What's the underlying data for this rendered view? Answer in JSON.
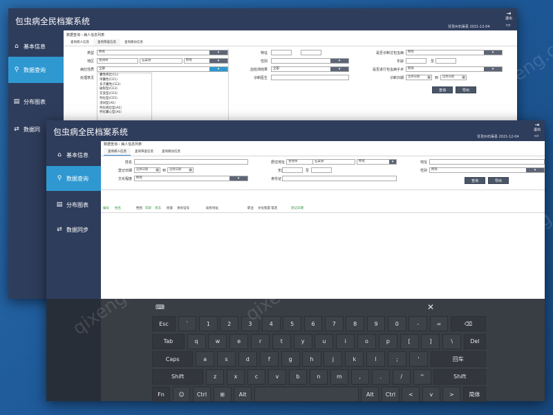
{
  "app": {
    "title": "包虫病全民档案系统",
    "datetime": "甘孜州石渠县 2021-12-04",
    "exit_label": "退出"
  },
  "sidebar": {
    "items": [
      {
        "icon": "home-icon",
        "label": "基本信息"
      },
      {
        "icon": "search-icon",
        "label": "数据查询"
      },
      {
        "icon": "chart-icon",
        "label": "分布图表"
      },
      {
        "icon": "sync-icon",
        "label": "数据同步"
      }
    ],
    "back_items": [
      {
        "label": "基本信息"
      },
      {
        "label": "数据查询"
      },
      {
        "label": "分布图表"
      },
      {
        "label": "数据同"
      }
    ],
    "version": "版本"
  },
  "back_window": {
    "breadcrumb": "数据查询 › 病人信息列表",
    "tabs": [
      "查询病人信息",
      "查询筛查信息",
      "查询随访信息"
    ],
    "fields": {
      "type_label": "类型",
      "type_value": "所有",
      "region_label": "地区",
      "region_city": "甘孜州",
      "region_county": "石渠县",
      "region_town": "所有",
      "lesion_label": "病灶性质",
      "lesion_value": "全部",
      "treatment_label": "处理意见",
      "feature_label": "特征",
      "gender_label": "性别",
      "serum_label": "血检测结果",
      "serum_value": "全部",
      "doctor_label": "诊断医生",
      "ever_diag_label": "是否诊断过包虫病",
      "ever_diag_value": "所有",
      "age_label": "年龄",
      "age_to": "至",
      "surgery_label": "是否进行包虫病手术",
      "surgery_value": "所有",
      "diag_date_label": "诊断日期",
      "date_placeholder": "选择日期",
      "date_to": "到"
    },
    "dropdown_options": [
      "囊性病灶(CL)",
      "单囊性(CE1)",
      "多子囊性(CE2)",
      "破裂型(CE3)",
      "实变型(CE4)",
      "钙化型(CE5)",
      "浸润型(AE)",
      "钙化病灶型(AE)",
      "钙化囊心型(AE)"
    ],
    "query_button": "查询",
    "export_button": "导出"
  },
  "front_window": {
    "breadcrumb": "数据查询 › 病人信息列表",
    "tabs": [
      "查询病人信息",
      "查询筛查信息",
      "查询随访信息"
    ],
    "fields": {
      "name_label": "姓名",
      "reg_date_label": "登记日期",
      "date_placeholder": "选择日期",
      "date_to": "到",
      "education_label": "文化程度",
      "education_value": "所有",
      "residence_label": "居住地址",
      "residence_city": "甘孜州",
      "residence_county": "石渠县",
      "residence_town": "所有",
      "age_label": "年龄",
      "age_to": "至",
      "idcard_label": "身份证",
      "address_label": "地址",
      "gender_label": "性别",
      "gender_value": "所有"
    },
    "query_button": "查询",
    "export_button": "导出",
    "table_headers": [
      {
        "text": "编号",
        "color": "green"
      },
      {
        "text": "姓名",
        "color": "green"
      },
      {
        "text": "性别",
        "color": "black"
      },
      {
        "text": "年龄",
        "color": "green"
      },
      {
        "text": "状态",
        "color": "green"
      },
      {
        "text": "民族",
        "color": "black"
      },
      {
        "text": "身份证号",
        "color": "black"
      },
      {
        "text": "居民地址",
        "color": "black"
      },
      {
        "text": "职业",
        "color": "black"
      },
      {
        "text": "文化程度",
        "color": "black"
      },
      {
        "text": "电话",
        "color": "black"
      },
      {
        "text": "登记日期",
        "color": "green"
      }
    ]
  },
  "keyboard": {
    "rows": [
      [
        "Esc",
        "`",
        "1",
        "2",
        "3",
        "4",
        "5",
        "6",
        "7",
        "8",
        "9",
        "0",
        "-",
        "=",
        "⌫"
      ],
      [
        "Tab",
        "q",
        "w",
        "e",
        "r",
        "t",
        "y",
        "u",
        "i",
        "o",
        "p",
        "[",
        "]",
        "\\",
        "Del"
      ],
      [
        "Caps",
        "a",
        "s",
        "d",
        "f",
        "g",
        "h",
        "j",
        "k",
        "l",
        ";",
        "'",
        "回车"
      ],
      [
        "Shift",
        "z",
        "x",
        "c",
        "v",
        "b",
        "n",
        "m",
        ",",
        ".",
        "/",
        "^",
        "Shift"
      ],
      [
        "Fn",
        "☺",
        "Ctrl",
        "⊞",
        "Alt",
        " ",
        "Alt",
        "Ctrl",
        "<",
        "v",
        ">",
        "简体"
      ]
    ]
  },
  "watermark": "qixeng.com"
}
